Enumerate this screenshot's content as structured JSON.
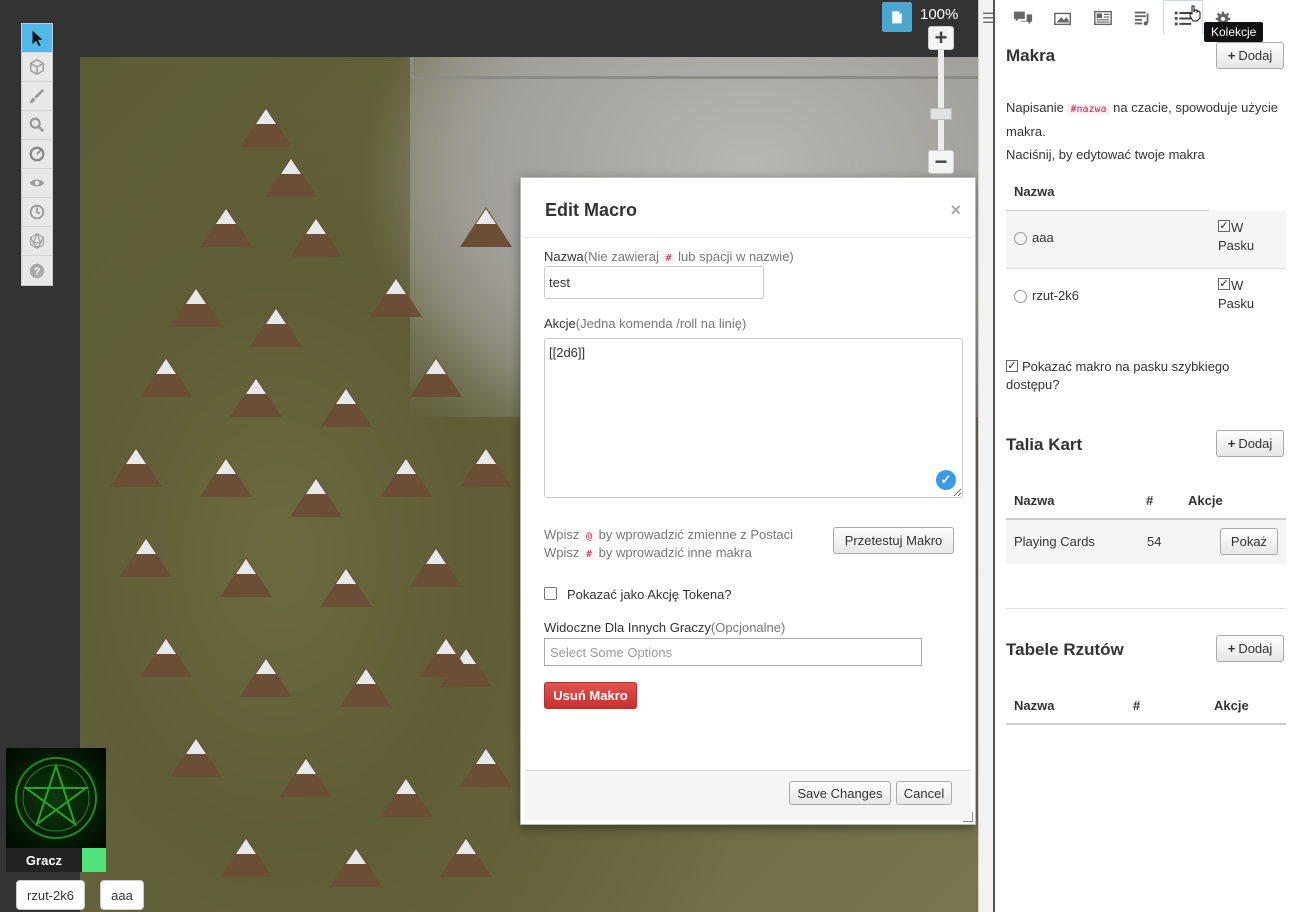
{
  "canvas": {
    "zoom_label": "100%",
    "toolbar": [
      "select",
      "layers",
      "draw",
      "zoom",
      "measure",
      "fog",
      "turn",
      "dice",
      "help"
    ]
  },
  "player": {
    "name": "Gracz",
    "color": "#50e37a"
  },
  "quick_bar": [
    "rzut-2k6",
    "aaa"
  ],
  "dialog": {
    "title": "Edit Macro",
    "close": "×",
    "name_label": "Nazwa",
    "name_hint_a": "(Nie zawieraj ",
    "name_hint_code": "#",
    "name_hint_b": " lub spacji w nazwie)",
    "name_value": "test",
    "action_label": "Akcje",
    "action_hint": "(Jedna komenda /roll na linię)",
    "action_value": "[[2d6]]",
    "hint1_a": "Wpisz ",
    "hint1_code": "@",
    "hint1_b": " by wprowadzić zmienne z Postaci",
    "hint2_a": "Wpisz ",
    "hint2_code": "#",
    "hint2_b": " by wprowadzić inne makra",
    "test_button": "Przetestuj Makro",
    "token_action_label": "Pokazać jako Akcję Tokena?",
    "visible_label": "Widoczne Dla Innych Graczy",
    "visible_hint": "(Opcjonalne)",
    "select_placeholder": "Select Some Options",
    "delete_button": "Usuń Makro",
    "save_button": "Save Changes",
    "cancel_button": "Cancel"
  },
  "sidebar": {
    "tooltip": "Kolekcje",
    "macros": {
      "title": "Makra",
      "add": "Dodaj",
      "desc_a": "Napisanie ",
      "desc_code": "#nazwa",
      "desc_b": " na czacie, spowoduje użycie",
      "desc_c": "makra.",
      "desc_d": "Naciśnij, by edytować twoje makra",
      "col_name": "Nazwa",
      "bar_label_a": "W",
      "bar_label_b": "Pasku",
      "items": [
        {
          "name": "aaa"
        },
        {
          "name": "rzut-2k6"
        }
      ],
      "quick_access_a": "Pokazać makro na pasku szybkiego",
      "quick_access_b": "dostępu?"
    },
    "decks": {
      "title": "Talia Kart",
      "add": "Dodaj",
      "col_name": "Nazwa",
      "col_count": "#",
      "col_actions": "Akcje",
      "items": [
        {
          "name": "Playing Cards",
          "count": "54",
          "action": "Pokaż"
        }
      ]
    },
    "tables": {
      "title": "Tabele Rzutów",
      "add": "Dodaj",
      "col_name": "Nazwa",
      "col_count": "#",
      "col_actions": "Akcje"
    }
  }
}
